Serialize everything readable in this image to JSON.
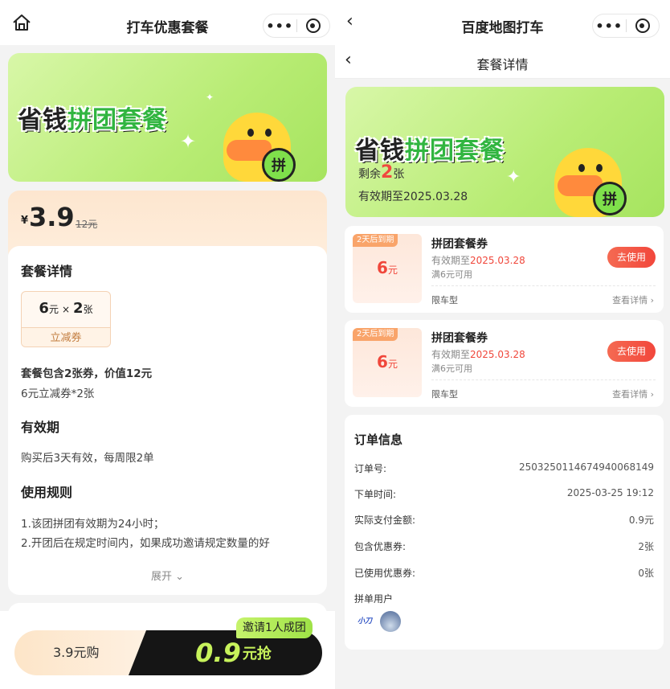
{
  "left": {
    "topbar": {
      "title": "打车优惠套餐",
      "more_glyph": "•••"
    },
    "banner": {
      "title_prefix": "省钱",
      "title_highlight": "拼团套餐",
      "badge": "拼"
    },
    "price": {
      "currency": "¥",
      "value": "3.9",
      "original": "12元"
    },
    "details": {
      "title": "套餐详情",
      "coupon": {
        "amount": "6",
        "unit": "元",
        "times": "×",
        "count": "2",
        "count_unit": "张",
        "label": "立减券"
      },
      "summary": "套餐包含2张券，价值12元",
      "summary_sub": "6元立减券*2张",
      "validity_title": "有效期",
      "validity_text": "购买后3天有效，每周限2单",
      "rules_title": "使用规则",
      "rule_1": "1.该团拼团有效期为24小时；",
      "rule_2": "2.开团后在规定时间内，如果成功邀请规定数量的好",
      "expand": "展开 ⌄"
    },
    "bottom": {
      "buy_label": "3.9元购",
      "invite_tag": "邀请1人成团",
      "group_price": "0.9",
      "group_suffix": "元抢"
    }
  },
  "right": {
    "topbar": {
      "title": "百度地图打车",
      "more_glyph": "•••"
    },
    "subbar": {
      "title": "套餐详情"
    },
    "banner": {
      "title_prefix": "省钱",
      "title_highlight": "拼团套餐",
      "remaining_prefix": "剩余",
      "remaining_count": "2",
      "remaining_suffix": "张",
      "valid_until": "有效期至2025.03.28",
      "badge": "拼"
    },
    "tickets": [
      {
        "expire_tag": "2天后到期",
        "amount": "6",
        "unit": "元",
        "title": "拼团套餐券",
        "valid_prefix": "有效期至",
        "valid_date": "2025.03.28",
        "min": "满6元可用",
        "type": "限车型",
        "more": "查看详情 ›",
        "button": "去使用"
      },
      {
        "expire_tag": "2天后到期",
        "amount": "6",
        "unit": "元",
        "title": "拼团套餐券",
        "valid_prefix": "有效期至",
        "valid_date": "2025.03.28",
        "min": "满6元可用",
        "type": "限车型",
        "more": "查看详情 ›",
        "button": "去使用"
      }
    ],
    "order": {
      "title": "订单信息",
      "rows": [
        {
          "k": "订单号:",
          "v": "2503250114674940068149"
        },
        {
          "k": "下单时间:",
          "v": "2025-03-25 19:12"
        },
        {
          "k": "实际支付金额:",
          "v": "0.9元"
        },
        {
          "k": "包含优惠券:",
          "v": "2张"
        },
        {
          "k": "已使用优惠券:",
          "v": "0张"
        }
      ],
      "group_label": "拼单用户",
      "avatar_1_text": "小刀"
    }
  },
  "colors": {
    "accent_red": "#f0473b",
    "accent_green": "#31b540",
    "lime": "#c7f25b",
    "banner_green": "#b8ec74"
  }
}
